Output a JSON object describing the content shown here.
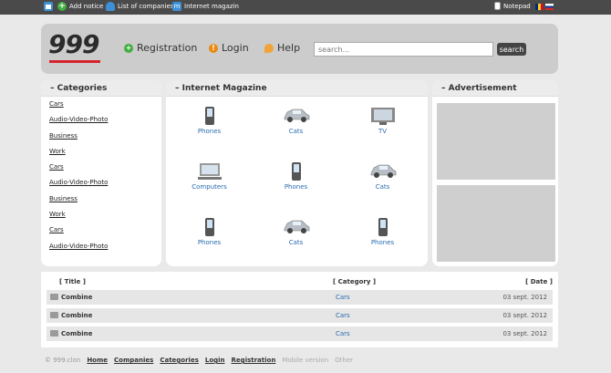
{
  "topbar": {
    "add_notice": "Add notice",
    "list_companies": "List of companies",
    "internet_magazine": "Internet magazin",
    "notepad": "Notepad"
  },
  "header": {
    "logo": "999",
    "registration": "Registration",
    "login": "Login",
    "help": "Help",
    "search_placeholder": "search...",
    "search_button": "search"
  },
  "categories": {
    "title": "Categories",
    "items": [
      "Cars",
      "Audio-Video-Photo",
      "Business",
      "Work",
      "Cars",
      "Audio-Video-Photo",
      "Business",
      "Work",
      "Cars",
      "Audio-Video-Photo"
    ]
  },
  "magazine": {
    "title": "Internet Magazine",
    "items": [
      {
        "label": "Phones",
        "icon": "phone-icon"
      },
      {
        "label": "Cats",
        "icon": "car-icon"
      },
      {
        "label": "TV",
        "icon": "tv-icon"
      },
      {
        "label": "Computers",
        "icon": "computer-icon"
      },
      {
        "label": "Phones",
        "icon": "phone-icon"
      },
      {
        "label": "Cats",
        "icon": "car-icon"
      },
      {
        "label": "Phones",
        "icon": "phone-icon"
      },
      {
        "label": "Cats",
        "icon": "car-icon"
      },
      {
        "label": "Phones",
        "icon": "phone-icon"
      }
    ]
  },
  "advertisement": {
    "title": "Advertisement"
  },
  "table": {
    "headers": {
      "title": "[ Title ]",
      "category": "[ Category ]",
      "date": "[ Date ]"
    },
    "rows": [
      {
        "title": "Combine",
        "category": "Cars",
        "date": "03 sept. 2012"
      },
      {
        "title": "Combine",
        "category": "Cars",
        "date": "03 sept. 2012"
      },
      {
        "title": "Combine",
        "category": "Cars",
        "date": "03 sept. 2012"
      }
    ]
  },
  "footer": {
    "copyright": "© 999.clon",
    "links": [
      "Home",
      "Companies",
      "Categories",
      "Login",
      "Registration"
    ],
    "mobile": "Mobile version",
    "other": "Other"
  },
  "colors": {
    "accent_red": "#d6242e",
    "link_blue": "#2a6bb0",
    "header_grey": "#cccccc",
    "topbar": "#4a4a4a"
  }
}
